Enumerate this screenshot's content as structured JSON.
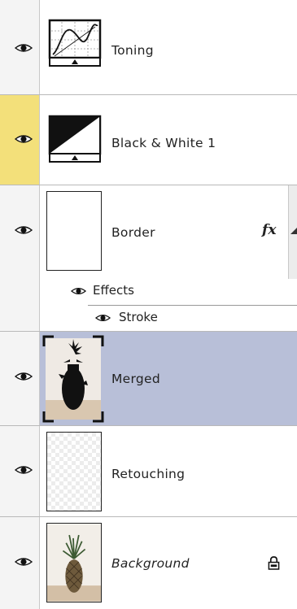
{
  "layers": [
    {
      "name": "Toning",
      "visible": true,
      "icon": "curves-adjustment-icon"
    },
    {
      "name": "Black & White 1",
      "visible": true,
      "icon": "black-white-adjustment-icon",
      "eye_highlight_color": "#f3e07a"
    },
    {
      "name": "Border",
      "visible": true,
      "has_fx": true,
      "fx_label": "fx",
      "effects": {
        "label": "Effects",
        "items": [
          {
            "label": "Stroke"
          }
        ]
      }
    },
    {
      "name": "Merged",
      "visible": true,
      "selected": true,
      "selected_color": "#b8bfd8"
    },
    {
      "name": "Retouching",
      "visible": true,
      "transparent": true
    },
    {
      "name": "Background",
      "visible": true,
      "italic": true,
      "locked": true,
      "icon": "lock-icon"
    }
  ]
}
